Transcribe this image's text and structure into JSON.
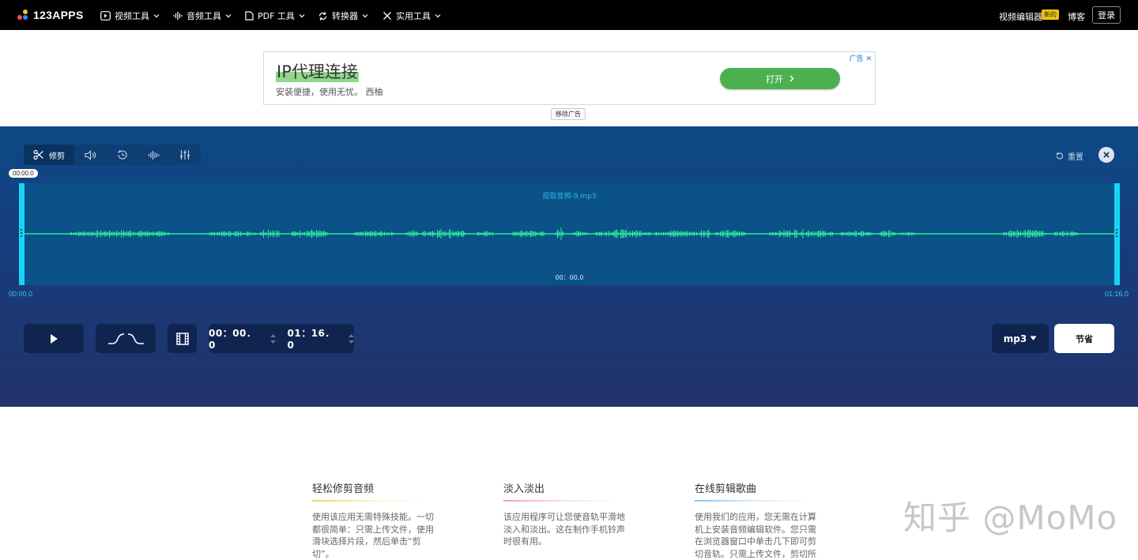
{
  "brand": {
    "name": "123APPS"
  },
  "nav": {
    "items": [
      {
        "label": "视频工具",
        "icon": "play-square-icon"
      },
      {
        "label": "音频工具",
        "icon": "audio-bars-icon"
      },
      {
        "label": "PDF 工具",
        "icon": "document-icon"
      },
      {
        "label": "转换器",
        "icon": "convert-arrows-icon"
      },
      {
        "label": "实用工具",
        "icon": "tools-icon"
      }
    ],
    "video_editor": "视频编辑器",
    "new_badge": "新的",
    "blog": "博客",
    "login": "登录"
  },
  "ad": {
    "title": "IP代理连接",
    "subtitle": "安装便捷，使用无忧。 西柚",
    "open_button": "打开",
    "tag": "广告",
    "remove_label": "移除广告"
  },
  "editor": {
    "toolbar": {
      "trim_label": "修剪",
      "tools": [
        "trim-tool",
        "volume-tool",
        "speed-tool",
        "equalizer-wave-tool",
        "mixer-tool"
      ]
    },
    "reset_label": "重置",
    "playhead_time": "00:00.0",
    "track_name": "提取音频-9.mp3",
    "track_position": "00：00.0",
    "start_label": "00:00.0",
    "end_label": "01:16.0",
    "start_time": "00：00．0",
    "end_time": "01：16．0",
    "format": "mp3",
    "save_label": "节省",
    "colors": {
      "waveform": "#2ee89a",
      "handle": "#15d6f6",
      "track_bg": "#0a5288"
    }
  },
  "features": [
    {
      "title": "轻松修剪音频",
      "body": "使用该应用无需特殊技能。一切都很简单：只需上传文件，使用滑块选择片段，然后单击“剪切”。",
      "accent": "#f0d35a"
    },
    {
      "title": "淡入淡出",
      "body": "该应用程序可让您使音轨平滑地淡入和淡出。这在制作手机铃声时很有用。",
      "accent": "#f3a0a0"
    },
    {
      "title": "在线剪辑歌曲",
      "body": "使用我们的应用，您无需在计算机上安装音频编辑软件。您只需在浏览器窗口中单击几下即可剪切音轨。只需上传文件，剪切所",
      "accent": "#7ec8f0"
    }
  ],
  "watermark": "知乎 @MoMo"
}
